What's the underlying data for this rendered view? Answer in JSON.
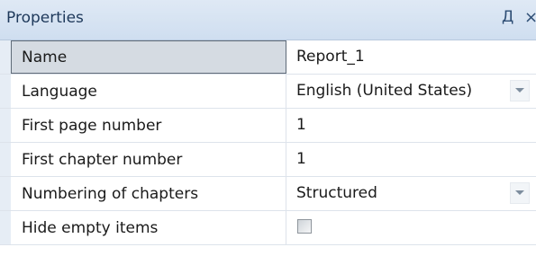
{
  "panel": {
    "title": "Properties",
    "pin_glyph": "Д",
    "close_glyph": "×"
  },
  "properties": [
    {
      "name": "Name",
      "value": "Report_1",
      "editor": "text",
      "selected": true
    },
    {
      "name": "Language",
      "value": "English (United States)",
      "editor": "dropdown"
    },
    {
      "name": "First page number",
      "value": "1",
      "editor": "text"
    },
    {
      "name": "First chapter number",
      "value": "1",
      "editor": "text"
    },
    {
      "name": "Numbering of chapters",
      "value": "Structured",
      "editor": "dropdown"
    },
    {
      "name": "Hide empty items",
      "value": "",
      "editor": "checkbox",
      "checked": false
    }
  ],
  "icons": {
    "pin": "pin-icon",
    "close": "close-icon",
    "dropdown": "chevron-down-icon"
  }
}
